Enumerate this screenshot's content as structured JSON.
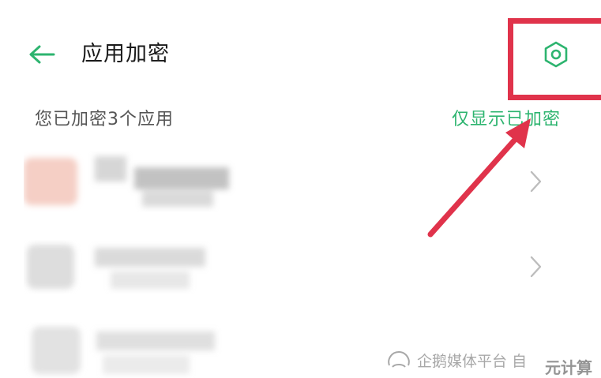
{
  "header": {
    "title": "应用加密",
    "back_icon": "arrow-left-icon",
    "settings_icon": "hexagon-gear-icon"
  },
  "summary": {
    "text": "您已加密3个应用",
    "filter_label": "仅显示已加密"
  },
  "apps": [
    {
      "name": "",
      "chevron_icon": "chevron-right-icon"
    },
    {
      "name": "",
      "chevron_icon": "chevron-right-icon"
    },
    {
      "name": "",
      "chevron_icon": ""
    }
  ],
  "watermark": {
    "text": "企鹅媒体平台 自",
    "extra": "元计算"
  },
  "colors": {
    "accent": "#2db46f",
    "annotation": "#e0334b",
    "text": "#1a1a1a",
    "muted": "#555555",
    "chevron": "#bdbdbd"
  }
}
